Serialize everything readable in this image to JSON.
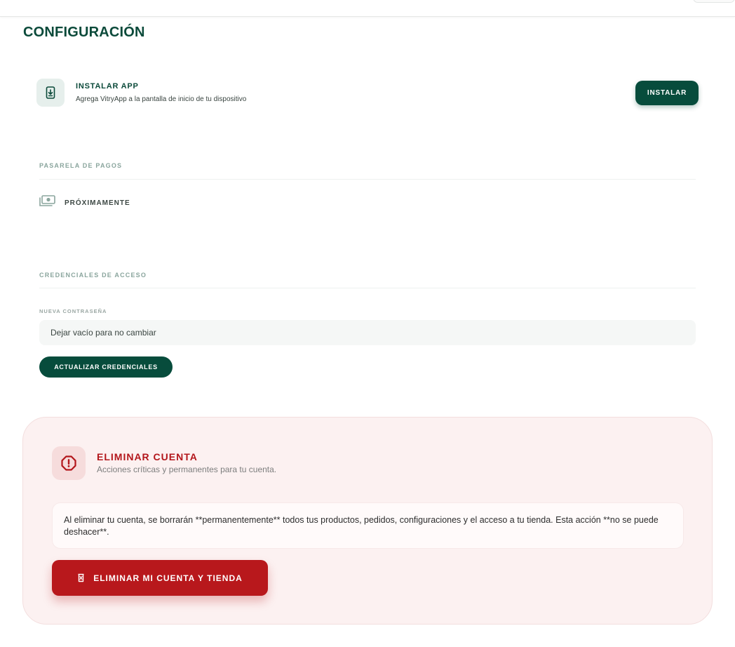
{
  "page": {
    "title": "CONFIGURACIÓN"
  },
  "install_app": {
    "icon": "phone-download-icon",
    "title": "INSTALAR APP",
    "description": "Agrega VitryApp a la pantalla de inicio de tu dispositivo",
    "button_label": "INSTALAR"
  },
  "payments": {
    "section_label": "PASARELA DE PAGOS",
    "icon": "money-icon",
    "status_label": "PRÓXIMAMENTE"
  },
  "credentials": {
    "section_label": "CREDENCIALES DE ACCESO",
    "field_label": "NUEVA CONTRASEÑA",
    "password_placeholder": "Dejar vacío para no cambiar",
    "password_value": "",
    "button_label": "ACTUALIZAR CREDENCIALES"
  },
  "delete_account": {
    "icon": "alert-octagon-icon",
    "title": "ELIMINAR CUENTA",
    "subtitle": "Acciones críticas y permanentes para tu cuenta.",
    "warning_text": "Al eliminar tu cuenta, se borrarán **permanentemente** todos tus productos, pedidos, configuraciones y el acceso a tu tienda. Esta acción **no se puede deshacer**.",
    "button_icon": "trash-icon",
    "button_label": "ELIMINAR MI CUENTA Y TIENDA"
  },
  "colors": {
    "brand_green": "#074c3c",
    "danger_red": "#b8181c",
    "danger_bg": "#fcf1f1"
  }
}
